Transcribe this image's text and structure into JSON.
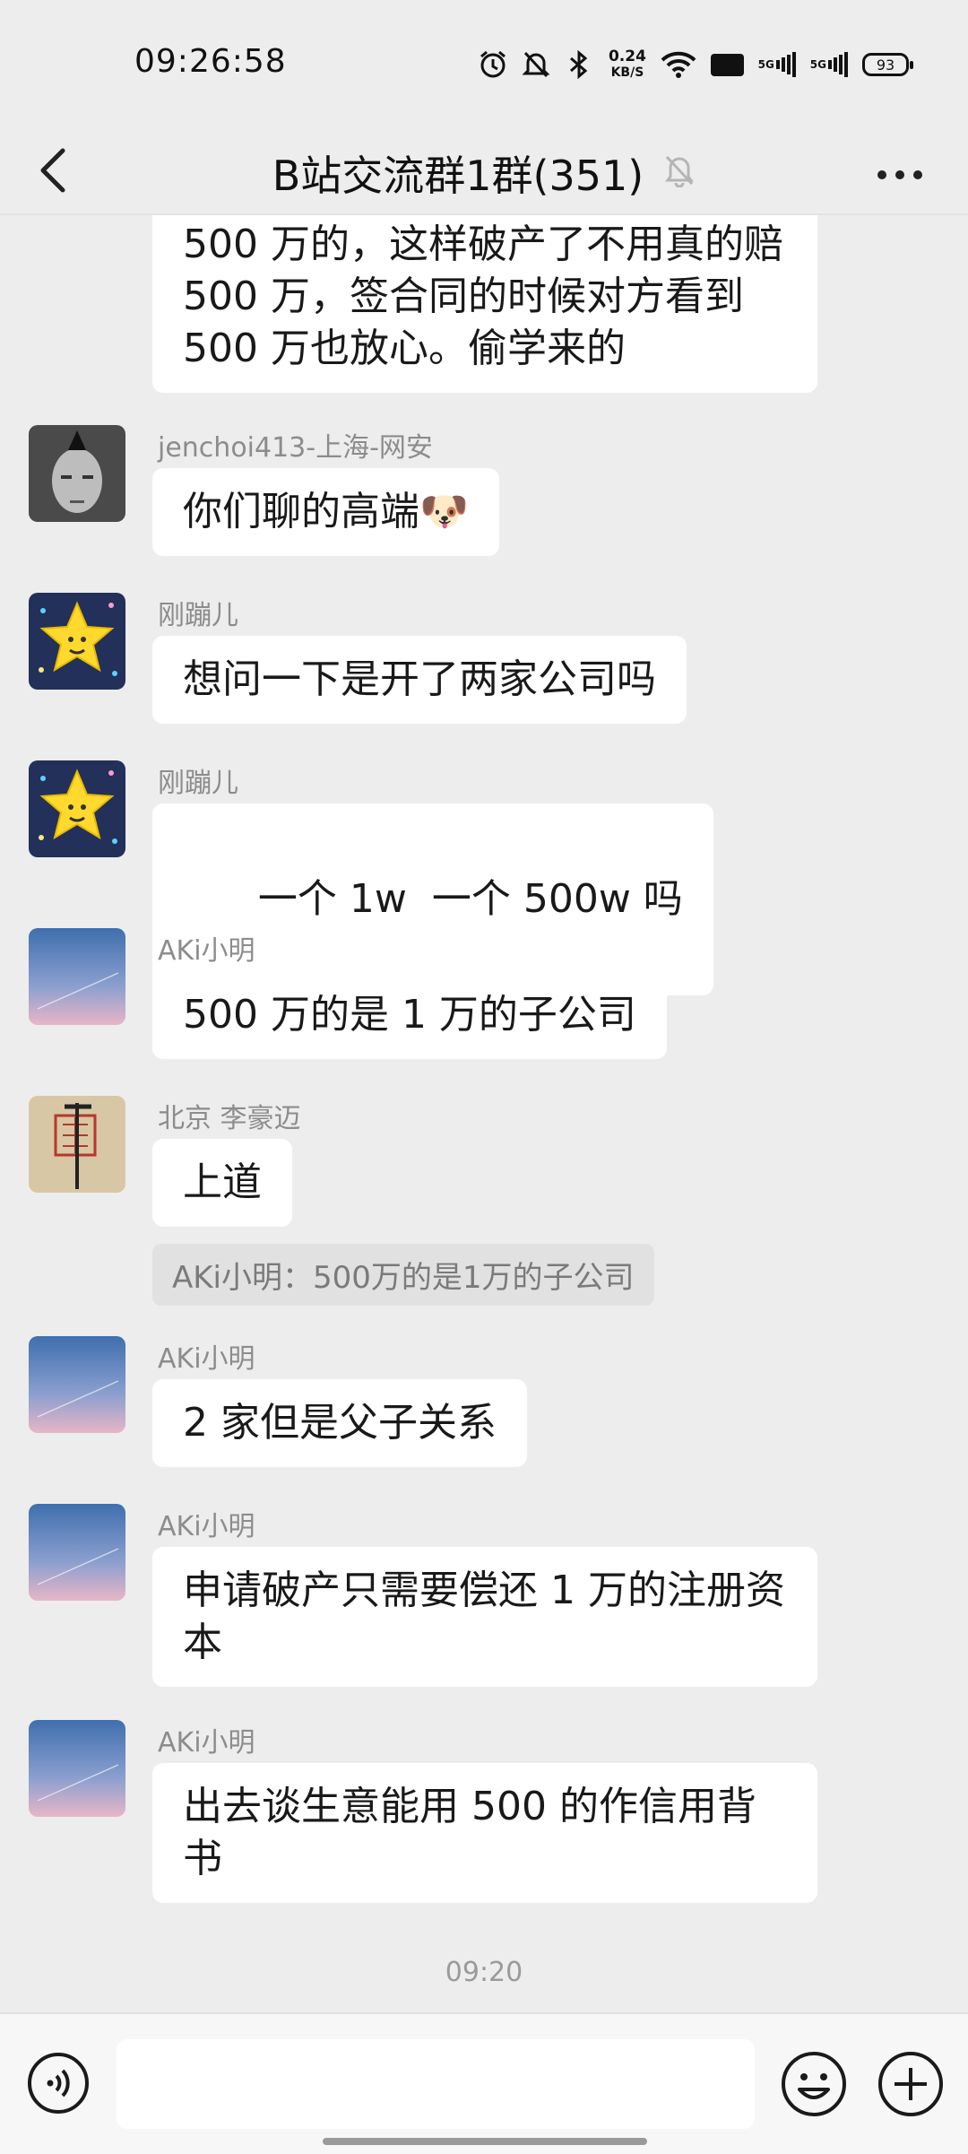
{
  "status_bar": {
    "time": "09:26:58",
    "net_speed_value": "0.24",
    "net_speed_unit": "KB/S",
    "hd_label": "HD",
    "signal1_label": "5G",
    "signal2_label": "5G",
    "battery": "93"
  },
  "header": {
    "title": "B站交流群1群(351)"
  },
  "messages": [
    {
      "text_lines": [
        "500 万的，这样破产了不用真的赔",
        "500 万，签合同的时候对方看到",
        "500 万也放心。偷学来的"
      ]
    },
    {
      "sender": "jenchoi413-上海-网安",
      "text": "你们聊的高端",
      "emoji": "🐶"
    },
    {
      "sender": "刚蹦儿",
      "text": "想问一下是开了两家公司吗"
    },
    {
      "sender": "刚蹦儿",
      "text": "一个 1w  一个 500w 吗"
    },
    {
      "sender": "AKi小明",
      "text": "500 万的是 1 万的子公司"
    },
    {
      "sender": "北京 李豪迈",
      "text": "上道",
      "quote": "AKi小明：500万的是1万的子公司"
    },
    {
      "sender": "AKi小明",
      "text": "2 家但是父子关系"
    },
    {
      "sender": "AKi小明",
      "text_lines": [
        "申请破产只需要偿还 1 万的注册资",
        "本"
      ]
    },
    {
      "sender": "AKi小明",
      "text_lines": [
        "出去谈生意能用 500 的作信用背",
        "书"
      ]
    }
  ],
  "timestamp": "09:20",
  "input": {
    "placeholder": ""
  },
  "colors": {
    "background": "#ededed",
    "bubble": "#ffffff",
    "sender": "#8c8c8c"
  },
  "icons": {
    "back": "chevron-left-icon",
    "mute": "bell-off-icon",
    "more": "more-dots-icon",
    "voice": "voice-icon",
    "emoji": "emoji-icon",
    "plus": "plus-icon"
  }
}
